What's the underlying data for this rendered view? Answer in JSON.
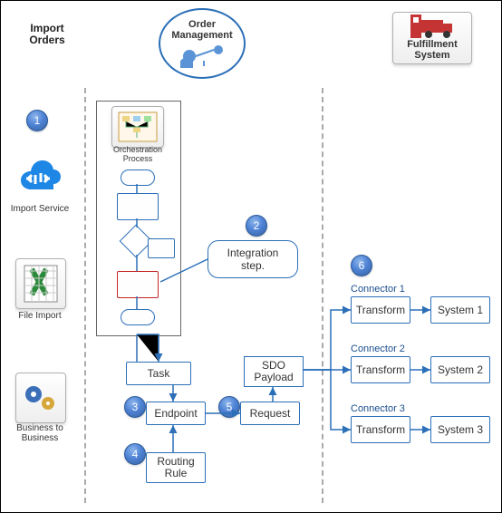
{
  "columns": {
    "import": "Import Orders",
    "order_mgmt": "Order Management",
    "fulfillment": "Fulfillment System"
  },
  "steps": {
    "s1": "1",
    "s2": "2",
    "s3": "3",
    "s4": "4",
    "s5": "5",
    "s6": "6"
  },
  "labels": {
    "import_service": "Import Service",
    "file_import": "File Import",
    "b2b": "Business to Business",
    "orchestration": "Orchestration Process",
    "integration_step": "Integration step.",
    "task": "Task",
    "endpoint": "Endpoint",
    "routing_rule": "Routing Rule",
    "request": "Request",
    "sdo_payload": "SDO Payload"
  },
  "connectors": {
    "c1": {
      "title": "Connector 1",
      "transform": "Transform",
      "system": "System 1"
    },
    "c2": {
      "title": "Connector 2",
      "transform": "Transform",
      "system": "System 2"
    },
    "c3": {
      "title": "Connector 3",
      "transform": "Transform",
      "system": "System 3"
    }
  },
  "chart_data": {
    "type": "diagram",
    "swimlanes": [
      "Import Orders",
      "Order Management",
      "Fulfillment System"
    ],
    "nodes": [
      {
        "id": "import_service",
        "lane": "Import Orders",
        "label": "Import Service",
        "type": "source"
      },
      {
        "id": "file_import",
        "lane": "Import Orders",
        "label": "File Import",
        "type": "source"
      },
      {
        "id": "b2b",
        "lane": "Import Orders",
        "label": "Business to Business",
        "type": "source"
      },
      {
        "id": "orchestration",
        "lane": "Order Management",
        "label": "Orchestration Process",
        "type": "process",
        "step": 1
      },
      {
        "id": "integration_step",
        "lane": "Order Management",
        "label": "Integration step.",
        "type": "callout",
        "step": 2
      },
      {
        "id": "task",
        "lane": "Order Management",
        "label": "Task",
        "type": "process"
      },
      {
        "id": "endpoint",
        "lane": "Order Management",
        "label": "Endpoint",
        "type": "process",
        "step": 3
      },
      {
        "id": "routing_rule",
        "lane": "Order Management",
        "label": "Routing Rule",
        "type": "process",
        "step": 4
      },
      {
        "id": "request",
        "lane": "Order Management",
        "label": "Request",
        "type": "process",
        "step": 5
      },
      {
        "id": "sdo_payload",
        "lane": "Order Management",
        "label": "SDO Payload",
        "type": "data"
      },
      {
        "id": "transform1",
        "lane": "Fulfillment System",
        "label": "Transform",
        "group": "Connector 1",
        "step": 6
      },
      {
        "id": "system1",
        "lane": "Fulfillment System",
        "label": "System 1",
        "group": "Connector 1"
      },
      {
        "id": "transform2",
        "lane": "Fulfillment System",
        "label": "Transform",
        "group": "Connector 2"
      },
      {
        "id": "system2",
        "lane": "Fulfillment System",
        "label": "System 2",
        "group": "Connector 2"
      },
      {
        "id": "transform3",
        "lane": "Fulfillment System",
        "label": "Transform",
        "group": "Connector 3"
      },
      {
        "id": "system3",
        "lane": "Fulfillment System",
        "label": "System 3",
        "group": "Connector 3"
      }
    ],
    "edges": [
      {
        "from": "orchestration",
        "to": "task"
      },
      {
        "from": "task",
        "to": "endpoint"
      },
      {
        "from": "routing_rule",
        "to": "endpoint"
      },
      {
        "from": "endpoint",
        "to": "request"
      },
      {
        "from": "request",
        "to": "sdo_payload"
      },
      {
        "from": "sdo_payload",
        "to": "transform1"
      },
      {
        "from": "sdo_payload",
        "to": "transform2"
      },
      {
        "from": "sdo_payload",
        "to": "transform3"
      },
      {
        "from": "transform1",
        "to": "system1"
      },
      {
        "from": "transform2",
        "to": "system2"
      },
      {
        "from": "transform3",
        "to": "system3"
      }
    ]
  }
}
